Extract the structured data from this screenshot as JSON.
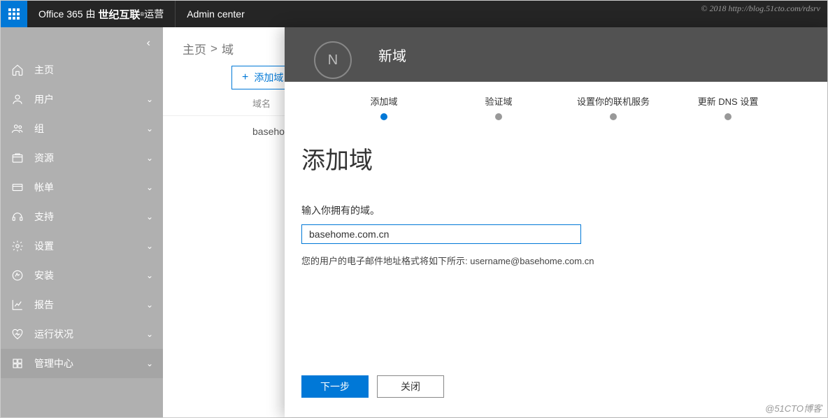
{
  "topbar": {
    "brand_prefix": "Office 365 由",
    "brand_bold": "世纪互联",
    "brand_suffix": "运营",
    "admin_center": "Admin center",
    "copyright": "© 2018 http://blog.51cto.com/rdsrv"
  },
  "sidebar": {
    "items": [
      {
        "label": "主页",
        "icon": "home",
        "expandable": false
      },
      {
        "label": "用户",
        "icon": "user",
        "expandable": true
      },
      {
        "label": "组",
        "icon": "group",
        "expandable": true
      },
      {
        "label": "资源",
        "icon": "resource",
        "expandable": true
      },
      {
        "label": "帐单",
        "icon": "billing",
        "expandable": true
      },
      {
        "label": "支持",
        "icon": "support",
        "expandable": true
      },
      {
        "label": "设置",
        "icon": "settings",
        "expandable": true
      },
      {
        "label": "安装",
        "icon": "install",
        "expandable": true
      },
      {
        "label": "报告",
        "icon": "reports",
        "expandable": true
      },
      {
        "label": "运行状况",
        "icon": "health",
        "expandable": true
      },
      {
        "label": "管理中心",
        "icon": "admin",
        "expandable": true,
        "darker": true
      }
    ]
  },
  "breadcrumb": {
    "home": "主页",
    "sep": ">",
    "current": "域"
  },
  "list": {
    "add_button": "添加域",
    "col_name": "域名",
    "row0": "basehom"
  },
  "panel": {
    "badge": "N",
    "title": "新域",
    "steps": [
      {
        "label": "添加域",
        "active": true
      },
      {
        "label": "验证域",
        "active": false
      },
      {
        "label": "设置你的联机服务",
        "active": false
      },
      {
        "label": "更新 DNS 设置",
        "active": false
      }
    ],
    "heading": "添加域",
    "field_label": "输入你拥有的域。",
    "input_value": "basehome.com.cn",
    "hint": "您的用户的电子邮件地址格式将如下所示: username@basehome.com.cn",
    "next_button": "下一步",
    "close_button": "关闭"
  },
  "watermark": "@51CTO博客"
}
